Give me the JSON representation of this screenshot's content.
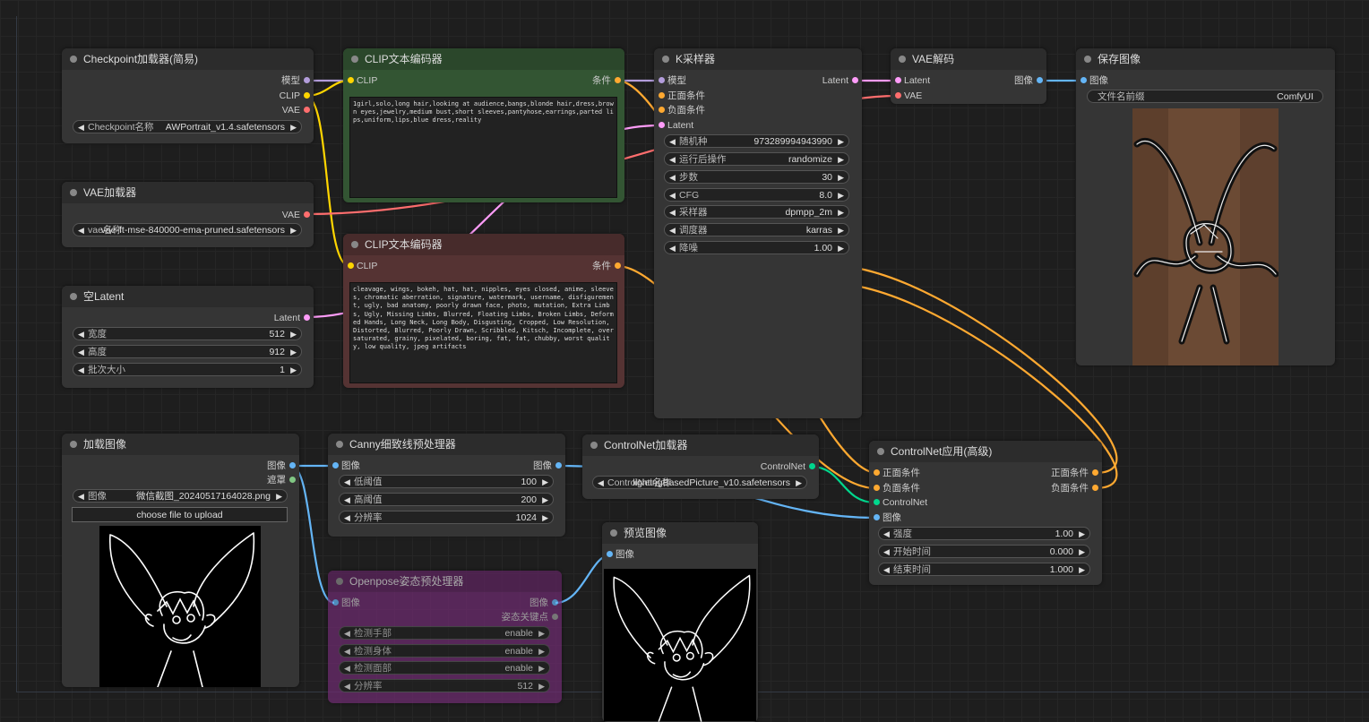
{
  "nodes": {
    "checkpoint": {
      "title": "Checkpoint加载器(简易)",
      "outputs": [
        "模型",
        "CLIP",
        "VAE"
      ],
      "ckpt_label": "Checkpoint名称",
      "ckpt_value": "AWPortrait_v1.4.safetensors"
    },
    "vae_loader": {
      "title": "VAE加载器",
      "output": "VAE",
      "vae_label": "vae名称",
      "vae_value": "vae-ft-mse-840000-ema-pruned.safetensors"
    },
    "empty_latent": {
      "title": "空Latent",
      "output": "Latent",
      "width_label": "宽度",
      "width_value": "512",
      "height_label": "高度",
      "height_value": "912",
      "batch_label": "批次大小",
      "batch_value": "1"
    },
    "clip_pos": {
      "title": "CLIP文本编码器",
      "input": "CLIP",
      "output": "条件",
      "text": "1girl,solo,long hair,looking at audience,bangs,blonde hair,dress,brown eyes,jewelry,medium bust,short sleeves,pantyhose,earrings,parted lips,uniform,lips,blue dress,reality"
    },
    "clip_neg": {
      "title": "CLIP文本编码器",
      "input": "CLIP",
      "output": "条件",
      "text": "cleavage, wings, bokeh, hat, hat, nipples, eyes closed, anime, sleeves, chromatic aberration, signature, watermark, username, disfigurement, ugly, bad anatomy, poorly drawn face, photo, mutation, Extra Limbs, Ugly, Missing Limbs, Blurred, Floating Limbs, Broken Limbs, Deformed Hands, Long Neck, Long Body, Disgusting, Cropped, Low Resolution, Distorted, Blurred, Poorly Drawn, Scribbled, Kitsch, Incomplete, oversaturated, grainy, pixelated, boring, fat, fat, chubby, worst quality, low quality, jpeg artifacts"
    },
    "ksampler": {
      "title": "K采样器",
      "inputs": [
        "模型",
        "正面条件",
        "负面条件",
        "Latent"
      ],
      "output": "Latent",
      "widgets": [
        {
          "label": "随机种",
          "value": "973289994943990"
        },
        {
          "label": "运行后操作",
          "value": "randomize"
        },
        {
          "label": "步数",
          "value": "30"
        },
        {
          "label": "CFG",
          "value": "8.0"
        },
        {
          "label": "采样器",
          "value": "dpmpp_2m"
        },
        {
          "label": "调度器",
          "value": "karras"
        },
        {
          "label": "降噪",
          "value": "1.00"
        }
      ]
    },
    "vae_decode": {
      "title": "VAE解码",
      "inputs": [
        "Latent",
        "VAE"
      ],
      "output": "图像"
    },
    "save_image": {
      "title": "保存图像",
      "input": "图像",
      "prefix_label": "文件名前缀",
      "prefix_value": "ComfyUI"
    },
    "load_image": {
      "title": "加载图像",
      "outputs": [
        "图像",
        "遮罩"
      ],
      "image_label": "图像",
      "image_value": "微信截图_20240517164028.png",
      "upload_label": "choose file to upload"
    },
    "canny": {
      "title": "Canny细致线预处理器",
      "input": "图像",
      "output": "图像",
      "low_label": "低阈值",
      "low_value": "100",
      "high_label": "高阈值",
      "high_value": "200",
      "res_label": "分辨率",
      "res_value": "1024"
    },
    "openpose": {
      "title": "Openpose姿态预处理器",
      "input": "图像",
      "outputs": [
        "图像",
        "姿态关键点"
      ],
      "widgets": [
        {
          "label": "检测手部",
          "value": "enable"
        },
        {
          "label": "检测身体",
          "value": "enable"
        },
        {
          "label": "检测面部",
          "value": "enable"
        },
        {
          "label": "分辨率",
          "value": "512"
        }
      ]
    },
    "controlnet_loader": {
      "title": "ControlNet加载器",
      "output": "ControlNet",
      "name_label": "ControlNet名称",
      "name_value": "lightingBasedPicture_v10.safetensors"
    },
    "preview": {
      "title": "预览图像",
      "input": "图像"
    },
    "controlnet_apply": {
      "title": "ControlNet应用(高级)",
      "inputs": [
        "正面条件",
        "负面条件",
        "ControlNet",
        "图像"
      ],
      "outputs": [
        "正面条件",
        "负面条件"
      ],
      "strength_label": "强度",
      "strength_value": "1.00",
      "start_label": "开始时间",
      "start_value": "0.000",
      "end_label": "结束时间",
      "end_value": "1.000"
    }
  },
  "colors": {
    "model": "#b39ddb",
    "clip": "#ffd500",
    "vae": "#ff6e6e",
    "conditioning": "#ffa931",
    "latent": "#ff9cf9",
    "image": "#64b5f6",
    "mask": "#81c784",
    "controlnet": "#00d78d"
  }
}
